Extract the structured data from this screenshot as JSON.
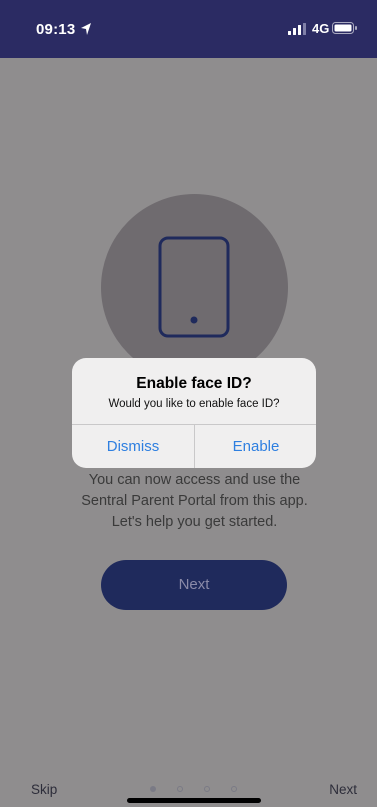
{
  "status_bar": {
    "time": "09:13",
    "network": "4G",
    "icons": [
      "location-arrow-icon",
      "signal-icon",
      "battery-icon"
    ]
  },
  "onboarding": {
    "icon": "phone-icon",
    "message_lines": [
      "You can now access and use the",
      "Sentral Parent Portal from this app.",
      "Let's help you get started."
    ],
    "next_button_label": "Next"
  },
  "bottom_bar": {
    "skip_label": "Skip",
    "next_label": "Next",
    "page_count": 4,
    "current_page": 1
  },
  "alert": {
    "title": "Enable face ID?",
    "message": "Would you like to enable face ID?",
    "dismiss_label": "Dismiss",
    "enable_label": "Enable"
  },
  "colors": {
    "status_bar": "#2b2b63",
    "primary_button": "#1f2a5c",
    "alert_action": "#2e7fe0",
    "overlay_background": "#8f8d8e"
  }
}
